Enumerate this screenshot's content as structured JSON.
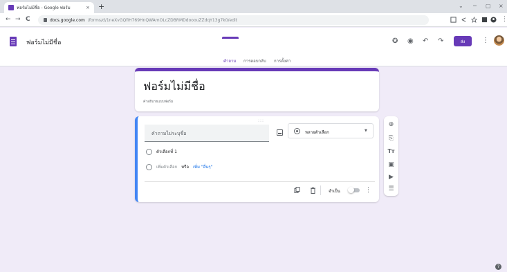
{
  "browser": {
    "tab_title": "ฟอร์มไม่มีชื่อ - Google ฟอร์ม",
    "tab_close": "×",
    "new_tab": "+",
    "url_host": "docs.google.com",
    "url_path": "/forms/d/1neXvGQfIH769HnQWAmOLcZDBRMDdooouZZdqY13g7k0/edit",
    "window_controls": {
      "minimize": "−",
      "maximize": "▢",
      "close": "×",
      "chevron": "⌄"
    },
    "nav": {
      "back": "←",
      "forward": "→",
      "reload": "C"
    }
  },
  "header": {
    "doc_title": "ฟอร์มไม่มีชื่อ",
    "send_label": "ส่ง",
    "tabs": [
      {
        "label": "คำถาม",
        "active": true
      },
      {
        "label": "การตอบกลับ",
        "active": false
      },
      {
        "label": "การตั้งค่า",
        "active": false
      }
    ],
    "icons": [
      "palette-icon",
      "eye-icon",
      "undo-icon",
      "redo-icon",
      "more-vert-icon"
    ]
  },
  "form": {
    "title": "ฟอร์มไม่มีชื่อ",
    "description": "คำอธิบายแบบฟอร์ม"
  },
  "question": {
    "placeholder": "คำถามไม่ระบุชื่อ",
    "type_label": "หลายตัวเลือก",
    "option_1": "ตัวเลือกที่ 1",
    "add_option": "เพิ่มตัวเลือก",
    "or_text": "หรือ",
    "add_other": "เพิ่ม \"อื่นๆ\"",
    "required_label": "จำเป็น",
    "required": false
  },
  "colors": {
    "brand": "#673ab7",
    "background": "#f0ebf8",
    "focus": "#4285f4",
    "link": "#1a73e8"
  }
}
